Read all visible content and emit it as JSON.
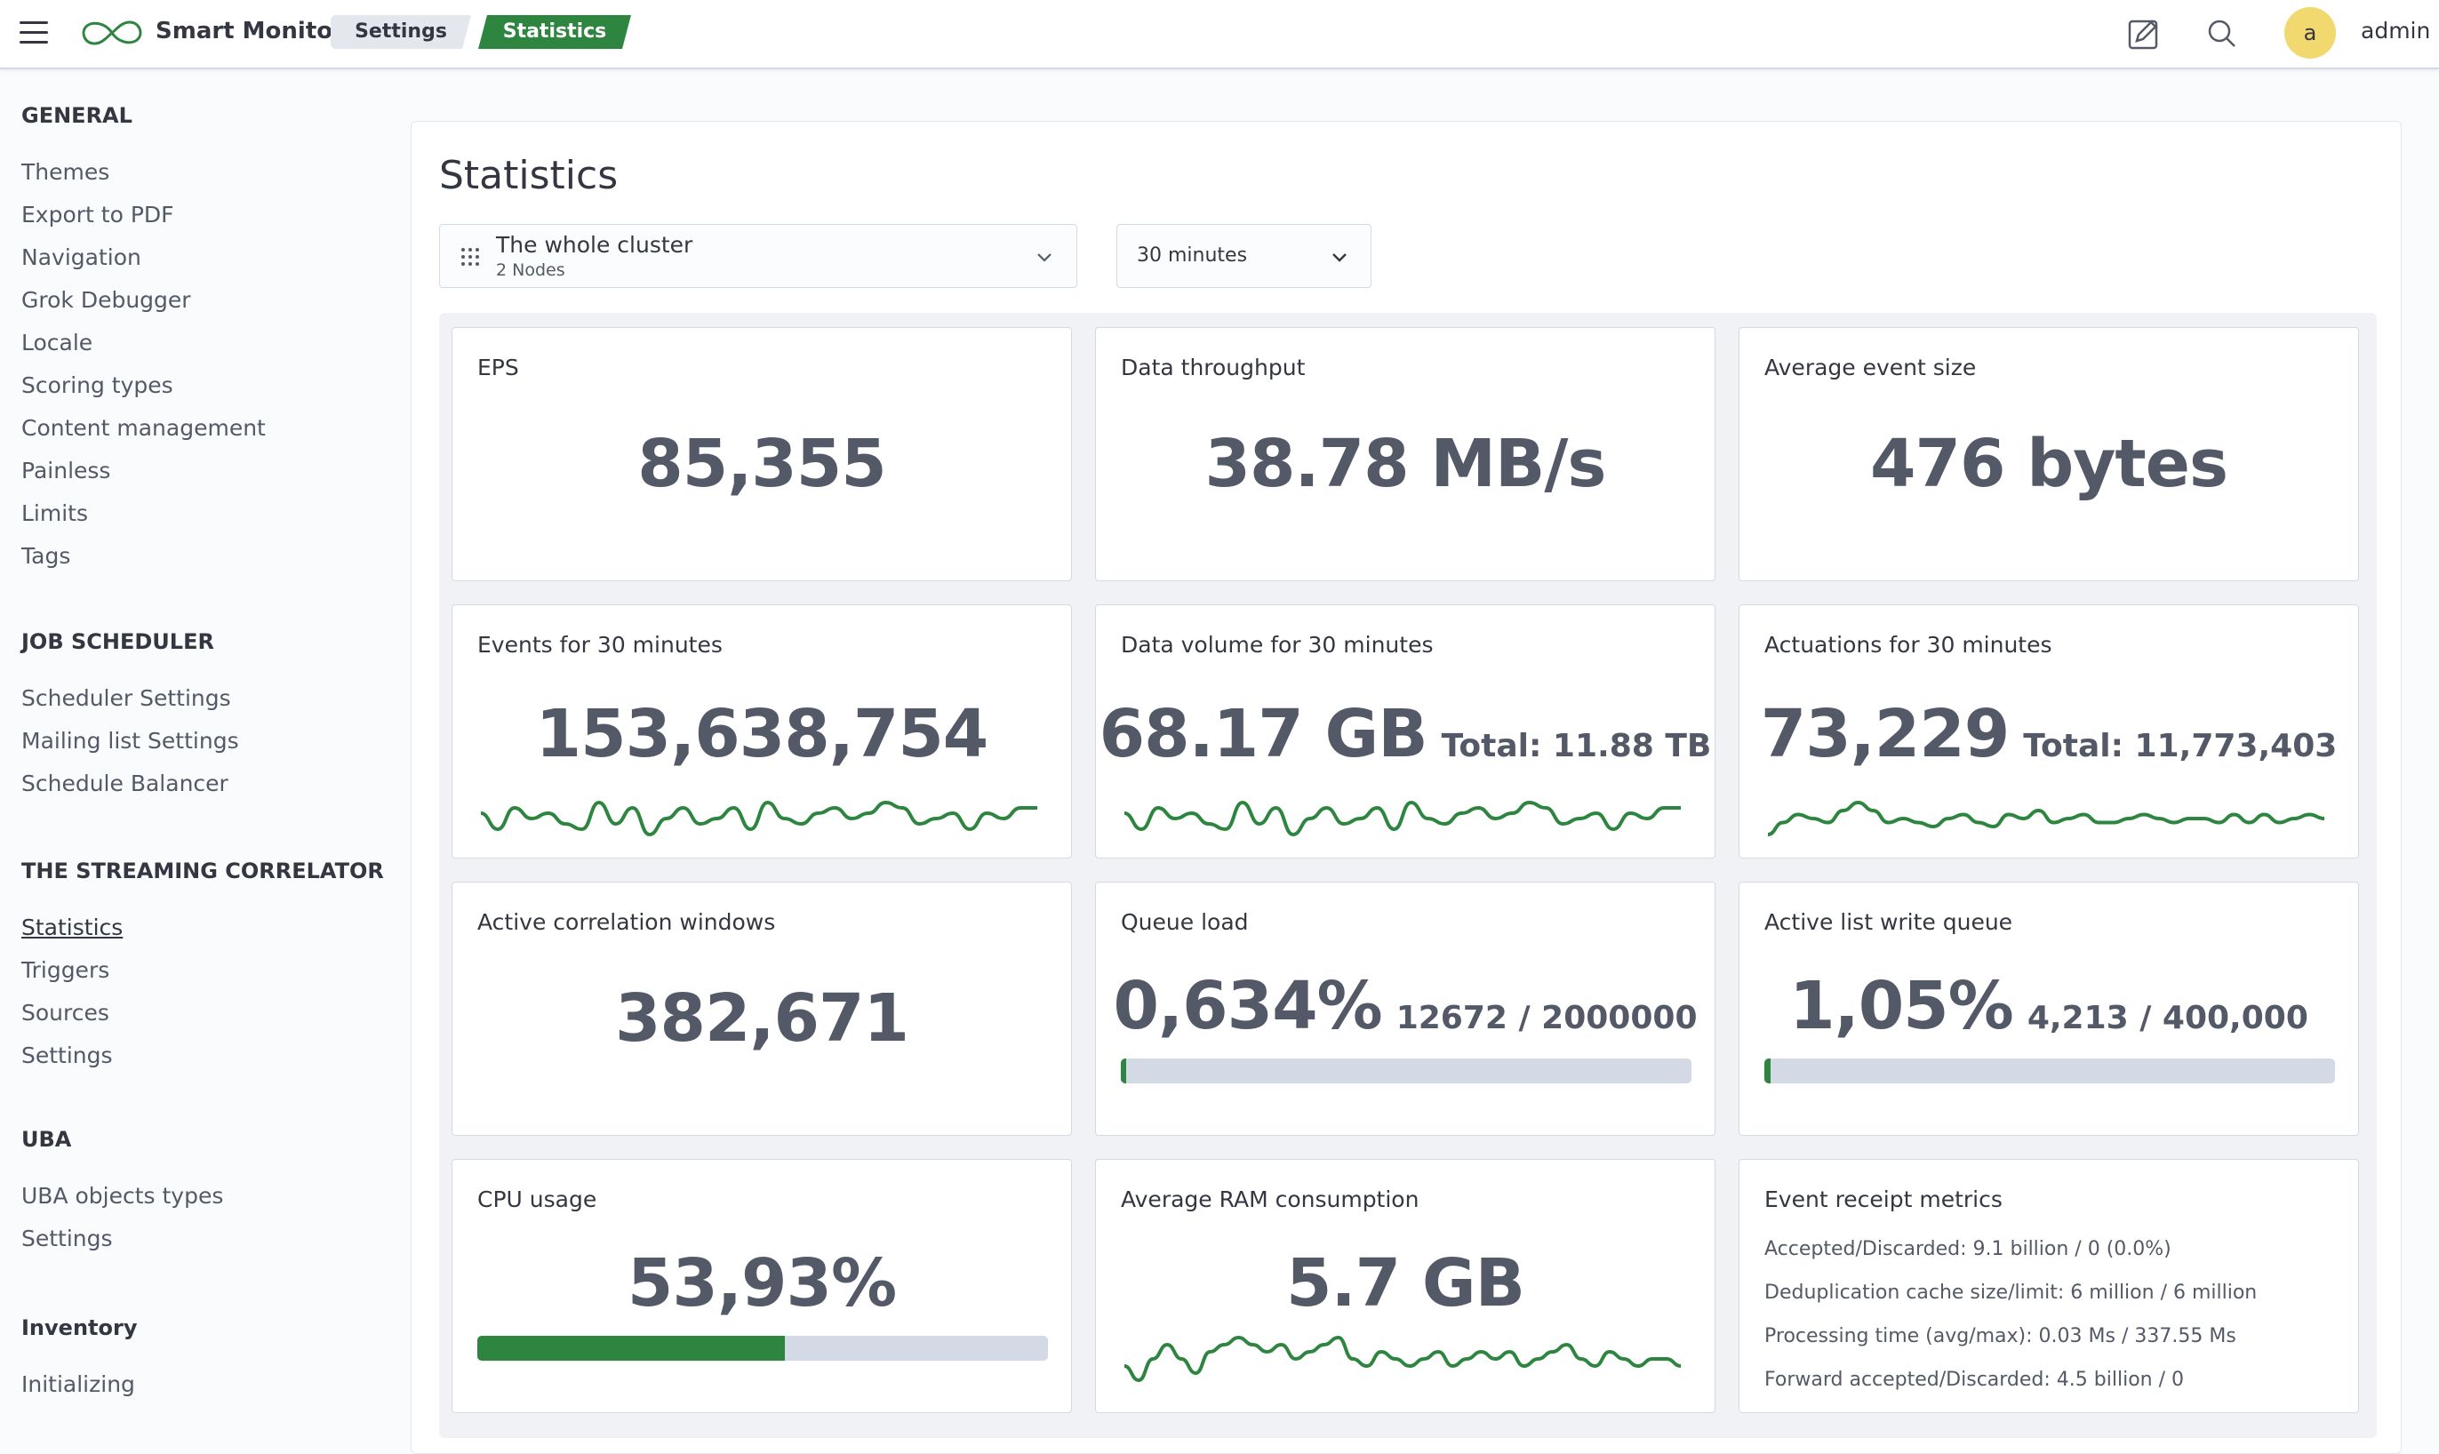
{
  "header": {
    "app_title": "Smart Monitor",
    "breadcrumbs": [
      "Settings",
      "Statistics"
    ],
    "avatar_initial": "a",
    "username": "admin",
    "accent_color": "#2e8540"
  },
  "sidebar": {
    "groups": [
      {
        "heading": "GENERAL",
        "items": [
          "Themes",
          "Export to PDF",
          "Navigation",
          "Grok Debugger",
          "Locale",
          "Scoring types",
          "Content management",
          "Painless",
          "Limits",
          "Tags"
        ]
      },
      {
        "heading": "JOB SCHEDULER",
        "items": [
          "Scheduler Settings",
          "Mailing list Settings",
          "Schedule Balancer"
        ]
      },
      {
        "heading": "THE STREAMING CORRELATOR",
        "items": [
          "Statistics",
          "Triggers",
          "Sources",
          "Settings"
        ],
        "active": "Statistics"
      },
      {
        "heading": "UBA",
        "items": [
          "UBA objects types",
          "Settings"
        ]
      },
      {
        "heading": "Inventory",
        "items": [
          "Initializing"
        ]
      }
    ]
  },
  "main": {
    "title": "Statistics",
    "cluster_select": {
      "value": "The whole cluster",
      "sub": "2 Nodes"
    },
    "time_select": {
      "value": "30 minutes"
    },
    "cards": {
      "eps": {
        "title": "EPS",
        "value": "85,355"
      },
      "throughput": {
        "title": "Data throughput",
        "value": "38.78 MB/s"
      },
      "avg_event_size": {
        "title": "Average event size",
        "value": "476 bytes"
      },
      "events": {
        "title": "Events for 30 minutes",
        "value": "153,638,754",
        "trend": [
          5,
          2,
          6,
          4,
          5,
          3,
          2,
          7,
          3,
          6,
          1,
          4,
          6,
          3,
          4,
          6,
          2,
          7,
          4,
          3,
          5,
          6,
          4,
          5,
          7,
          6,
          3,
          4,
          5,
          2,
          5,
          4,
          6,
          6
        ]
      },
      "volume": {
        "title": "Data volume for 30 minutes",
        "value": "68.17 GB",
        "sub": "Total: 11.88 TB",
        "trend": [
          5,
          2,
          6,
          4,
          5,
          3,
          2,
          7,
          3,
          6,
          1,
          4,
          6,
          3,
          4,
          6,
          2,
          7,
          4,
          3,
          5,
          6,
          4,
          5,
          7,
          6,
          3,
          4,
          5,
          2,
          5,
          4,
          6,
          6
        ]
      },
      "actuations": {
        "title": "Actuations for 30 minutes",
        "value": "73,229",
        "sub": "Total: 11,773,403",
        "trend": [
          1,
          4,
          6,
          5,
          4,
          7,
          9,
          7,
          4,
          5,
          4,
          3,
          5,
          6,
          4,
          3,
          6,
          5,
          7,
          4,
          5,
          6,
          4,
          4,
          5,
          6,
          5,
          4,
          5,
          5,
          4,
          6,
          4,
          6,
          4,
          5,
          6,
          5
        ]
      },
      "correlation": {
        "title": "Active correlation windows",
        "value": "382,671"
      },
      "queue": {
        "title": "Queue load",
        "value": "0,634%",
        "sub": "12672 / 2000000",
        "fill": 0.00634
      },
      "list_queue": {
        "title": "Active list write queue",
        "value": "1,05%",
        "sub": "4,213 / 400,000",
        "fill": 0.0105
      },
      "cpu": {
        "title": "CPU usage",
        "value": "53,93%",
        "fill": 0.5393
      },
      "ram": {
        "title": "Average RAM consumption",
        "value": "5.7 GB",
        "trend": [
          3,
          1,
          4,
          6,
          4,
          2,
          5,
          6,
          7,
          6,
          5,
          6,
          4,
          5,
          6,
          7,
          4,
          3,
          5,
          4,
          3,
          4,
          5,
          3,
          4,
          5,
          4,
          5,
          3,
          4,
          5,
          6,
          4,
          3,
          5,
          4,
          3,
          4,
          4,
          3
        ]
      },
      "receipt": {
        "title": "Event receipt metrics",
        "lines": [
          "Accepted/Discarded: 9.1 billion / 0 (0.0%)",
          "Deduplication cache size/limit: 6 million / 6 million",
          "Processing time (avg/max): 0.03 Ms / 337.55 Ms",
          "Forward accepted/Discarded: 4.5 billion / 0"
        ]
      }
    }
  }
}
